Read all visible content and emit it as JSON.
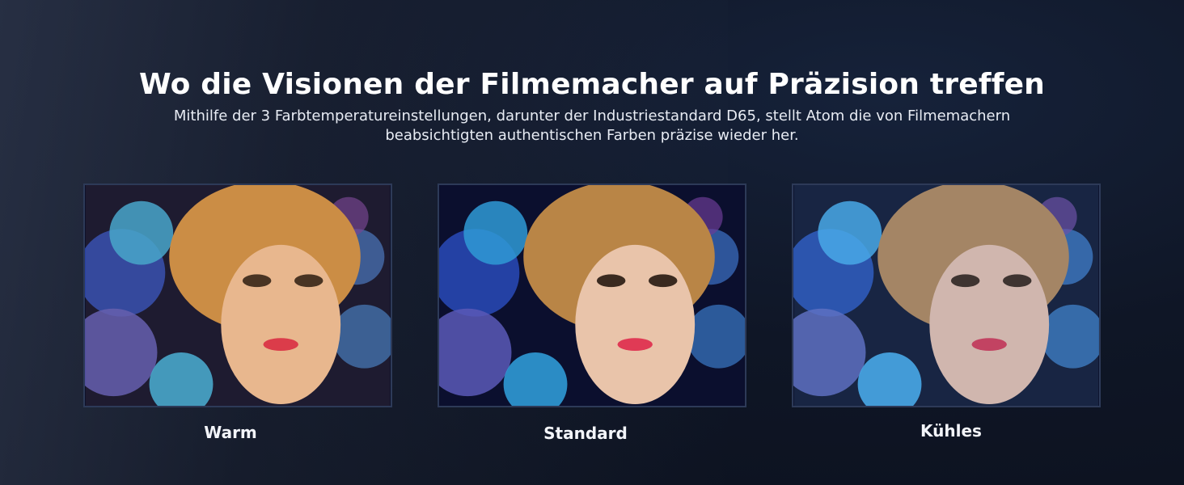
{
  "headline": "Wo die Visionen der Filmemacher auf Präzision treffen",
  "subtitle": "Mithilfe der 3 Farbtemperatureinstellungen, darunter der Industriestandard D65, stellt Atom die von Filmemachern beabsichtigten authentischen Farben präzise wieder her.",
  "modes": [
    {
      "label": "Warm",
      "skin": "#e7b894",
      "hair": "#c78a45",
      "flower": "#3aa6d6",
      "tint": "#ffb24a"
    },
    {
      "label": "Standard",
      "skin": "#e9c4aa",
      "hair": "#b98546",
      "flower": "#2f9ad6",
      "tint": "#ffffff"
    },
    {
      "label": "Kühles",
      "skin": "#d8b7a8",
      "hair": "#a98258",
      "flower": "#45a9e6",
      "tint": "#6fb0ff"
    }
  ]
}
